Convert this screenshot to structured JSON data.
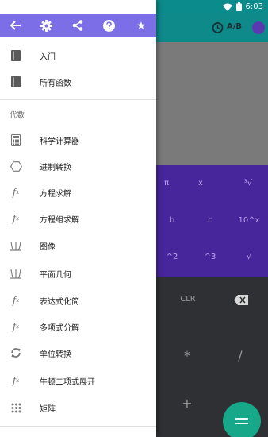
{
  "status_bar": {
    "time": "6:03"
  },
  "calculator": {
    "toolbar": {
      "ab_label": "A/B"
    },
    "scientific_keys": [
      "π",
      "x",
      "³√",
      "b",
      "c",
      "10^x",
      "^2",
      "^3",
      "√"
    ],
    "numeric_keys": [
      "CLR",
      "*",
      "/",
      "+",
      "−"
    ],
    "colors": {
      "toolbar": "#0e8a8a",
      "scientific_pad": "#47269b",
      "numeric_pad": "#2f3033",
      "fab": "#17a88a"
    }
  },
  "drawer": {
    "header_icons": [
      "back-arrow-icon",
      "gear-icon",
      "share-icon",
      "help-icon",
      "star-icon"
    ],
    "top_items": [
      {
        "label": "入门",
        "icon": "book-icon"
      },
      {
        "label": "所有函数",
        "icon": "book-icon"
      }
    ],
    "section_title": "代数",
    "items": [
      {
        "label": "科学计算器",
        "icon": "calculator-icon"
      },
      {
        "label": "进制转换",
        "icon": "hexagon-icon"
      },
      {
        "label": "方程求解",
        "icon": "function-icon"
      },
      {
        "label": "方程组求解",
        "icon": "function-icon"
      },
      {
        "label": "图像",
        "icon": "graph-icon"
      },
      {
        "label": "平面几何",
        "icon": "graph-icon"
      },
      {
        "label": "表达式化简",
        "icon": "function-icon"
      },
      {
        "label": "多项式分解",
        "icon": "function-icon"
      },
      {
        "label": "单位转换",
        "icon": "sync-icon"
      },
      {
        "label": "牛顿二项式展开",
        "icon": "function-icon"
      },
      {
        "label": "矩阵",
        "icon": "grid-icon"
      }
    ],
    "colors": {
      "header": "#7c6ee6"
    }
  }
}
